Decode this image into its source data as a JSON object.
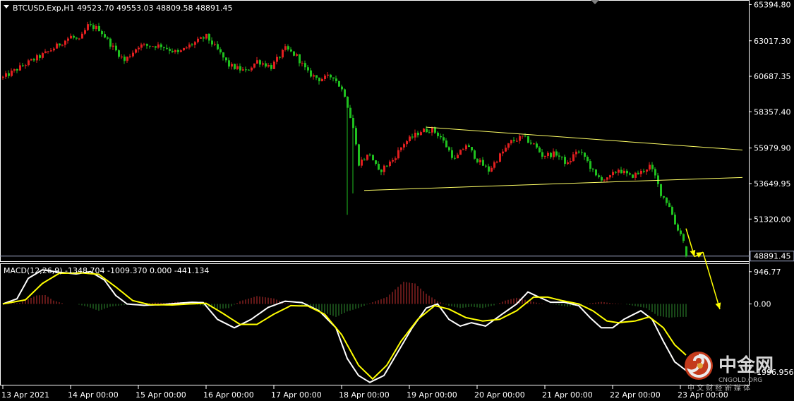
{
  "header": {
    "symbol_info": "BTCUSD.Exp,H1  49523.70 49553.03 48809.58 48891.45",
    "dropdown_icon": "triangle-down-icon"
  },
  "macd_header": "MACD(12,26,9) -1348.704 -1009.370 0.000 -441.134",
  "watermark": {
    "brand": "中金网",
    "domain": "CNGOLD.ORG",
    "tagline": "中 文 财 经 新 媒 体",
    "logo_icon": "cngold-swirl-logo-icon",
    "brand_color": "#d5401f"
  },
  "colors": {
    "background": "#000000",
    "bull": "#e21f1f",
    "bear": "#1fc01f",
    "trendline": "#ffff66",
    "arrow": "#ffff00",
    "macd_line": "#ffffff",
    "signal_line": "#ffff00",
    "hist_pos": "#c43131",
    "hist_neg": "#2f8f2f",
    "price_line": "#9fa8c8"
  },
  "chart_data": [
    {
      "type": "candlestick",
      "title": "BTCUSD.Exp,H1",
      "timeframe": "H1",
      "last_bar": {
        "open": 49523.7,
        "high": 49553.03,
        "low": 48809.58,
        "close": 48891.45
      },
      "current_price_label": "48891.45",
      "y_ticks": [
        "65394.80",
        "63017.30",
        "60687.35",
        "58357.40",
        "55979.90",
        "53649.95",
        "51320.00"
      ],
      "y_tick_values": [
        65394.8,
        63017.3,
        60687.35,
        58357.4,
        55979.9,
        53649.95,
        51320.0
      ],
      "ylim": [
        48600,
        65600
      ],
      "x_ticks": [
        "13 Apr 2021",
        "14 Apr 00:00",
        "15 Apr 00:00",
        "16 Apr 00:00",
        "17 Apr 00:00",
        "18 Apr 00:00",
        "19 Apr 00:00",
        "20 Apr 00:00",
        "21 Apr 00:00",
        "22 Apr 00:00",
        "23 Apr 00:00"
      ],
      "bar_count": 243,
      "close_path": [
        [
          0,
          60600
        ],
        [
          8,
          61500
        ],
        [
          16,
          62300
        ],
        [
          24,
          63300
        ],
        [
          27,
          63000
        ],
        [
          30,
          64000
        ],
        [
          34,
          63800
        ],
        [
          38,
          62800
        ],
        [
          43,
          61700
        ],
        [
          48,
          62700
        ],
        [
          56,
          62700
        ],
        [
          62,
          62200
        ],
        [
          66,
          62700
        ],
        [
          72,
          63300
        ],
        [
          76,
          62400
        ],
        [
          80,
          61400
        ],
        [
          86,
          61000
        ],
        [
          90,
          61700
        ],
        [
          95,
          61300
        ],
        [
          100,
          62500
        ],
        [
          104,
          62000
        ],
        [
          108,
          60900
        ],
        [
          112,
          60500
        ],
        [
          117,
          60700
        ],
        [
          121,
          59500
        ],
        [
          124,
          57300
        ],
        [
          126,
          55000
        ],
        [
          130,
          55600
        ],
        [
          133,
          54400
        ],
        [
          138,
          55200
        ],
        [
          142,
          56300
        ],
        [
          148,
          57100
        ],
        [
          152,
          57200
        ],
        [
          155,
          56700
        ],
        [
          160,
          55200
        ],
        [
          164,
          56200
        ],
        [
          168,
          55200
        ],
        [
          172,
          54500
        ],
        [
          176,
          55500
        ],
        [
          180,
          56400
        ],
        [
          184,
          56700
        ],
        [
          188,
          56200
        ],
        [
          191,
          55500
        ],
        [
          196,
          55600
        ],
        [
          200,
          54900
        ],
        [
          203,
          55800
        ],
        [
          206,
          55400
        ],
        [
          210,
          54100
        ],
        [
          214,
          53900
        ],
        [
          218,
          54600
        ],
        [
          222,
          54100
        ],
        [
          226,
          54400
        ],
        [
          229,
          54800
        ],
        [
          231,
          54100
        ],
        [
          233,
          53000
        ],
        [
          236,
          52200
        ],
        [
          238,
          51000
        ],
        [
          241,
          50000
        ],
        [
          242,
          48891.45
        ]
      ],
      "bar_anomalies": [
        {
          "index": 122,
          "low": 51600
        },
        {
          "index": 124,
          "low": 53000
        }
      ],
      "trendlines": [
        {
          "from": {
            "x": 150,
            "y": 57350
          },
          "to": {
            "x": 262,
            "y": 55850
          },
          "color": "trendline"
        },
        {
          "from": {
            "x": 128,
            "y": 53200
          },
          "to": {
            "x": 262,
            "y": 54050
          },
          "color": "trendline"
        }
      ],
      "arrows": [
        {
          "from": {
            "x": 242,
            "y": 50700
          },
          "to": {
            "x": 245,
            "y": 48850
          }
        },
        {
          "from": {
            "x": 245,
            "y": 48850
          },
          "to": {
            "x": 248,
            "y": 49150
          }
        },
        {
          "from": {
            "x": 248,
            "y": 49150
          },
          "to": {
            "x": 254,
            "y": 45400
          }
        }
      ]
    },
    {
      "type": "macd",
      "title": "MACD(12,26,9)",
      "values": {
        "macd": -1348.704,
        "signal": -1009.37,
        "zero": 0.0,
        "histogram": -441.134
      },
      "y_ticks": [
        "946.77",
        "0.00",
        "-1996.956"
      ],
      "y_tick_values": [
        946.77,
        0.0,
        -1996.956
      ],
      "ylim": [
        -2350,
        1150
      ],
      "bar_count": 243,
      "macd_path": [
        [
          0,
          0
        ],
        [
          5,
          150
        ],
        [
          9,
          750
        ],
        [
          14,
          1000
        ],
        [
          20,
          930
        ],
        [
          26,
          880
        ],
        [
          31,
          950
        ],
        [
          36,
          700
        ],
        [
          40,
          250
        ],
        [
          44,
          0
        ],
        [
          50,
          -40
        ],
        [
          56,
          -20
        ],
        [
          62,
          20
        ],
        [
          67,
          50
        ],
        [
          71,
          40
        ],
        [
          76,
          -450
        ],
        [
          82,
          -700
        ],
        [
          88,
          -450
        ],
        [
          94,
          -100
        ],
        [
          100,
          80
        ],
        [
          106,
          40
        ],
        [
          112,
          -200
        ],
        [
          118,
          -700
        ],
        [
          122,
          -1600
        ],
        [
          126,
          -2100
        ],
        [
          130,
          -2300
        ],
        [
          135,
          -2100
        ],
        [
          140,
          -1400
        ],
        [
          145,
          -700
        ],
        [
          150,
          -120
        ],
        [
          154,
          0
        ],
        [
          158,
          -450
        ],
        [
          162,
          -650
        ],
        [
          166,
          -550
        ],
        [
          171,
          -650
        ],
        [
          176,
          -350
        ],
        [
          182,
          0
        ],
        [
          186,
          350
        ],
        [
          190,
          200
        ],
        [
          194,
          50
        ],
        [
          199,
          50
        ],
        [
          204,
          -50
        ],
        [
          208,
          -400
        ],
        [
          212,
          -700
        ],
        [
          216,
          -700
        ],
        [
          220,
          -450
        ],
        [
          226,
          -200
        ],
        [
          230,
          -450
        ],
        [
          234,
          -1100
        ],
        [
          238,
          -1700
        ],
        [
          242,
          -1950
        ]
      ],
      "signal_path": [
        [
          0,
          0
        ],
        [
          8,
          120
        ],
        [
          14,
          600
        ],
        [
          20,
          900
        ],
        [
          28,
          910
        ],
        [
          34,
          870
        ],
        [
          40,
          500
        ],
        [
          46,
          100
        ],
        [
          52,
          -20
        ],
        [
          60,
          -30
        ],
        [
          66,
          0
        ],
        [
          72,
          20
        ],
        [
          78,
          -280
        ],
        [
          84,
          -600
        ],
        [
          90,
          -600
        ],
        [
          96,
          -300
        ],
        [
          102,
          -50
        ],
        [
          108,
          -60
        ],
        [
          114,
          -300
        ],
        [
          120,
          -900
        ],
        [
          126,
          -1800
        ],
        [
          131,
          -2200
        ],
        [
          136,
          -1800
        ],
        [
          141,
          -1100
        ],
        [
          147,
          -450
        ],
        [
          153,
          -50
        ],
        [
          158,
          -150
        ],
        [
          164,
          -400
        ],
        [
          170,
          -500
        ],
        [
          176,
          -450
        ],
        [
          182,
          -200
        ],
        [
          188,
          200
        ],
        [
          193,
          200
        ],
        [
          198,
          100
        ],
        [
          204,
          0
        ],
        [
          209,
          -200
        ],
        [
          214,
          -500
        ],
        [
          218,
          -550
        ],
        [
          224,
          -500
        ],
        [
          229,
          -380
        ],
        [
          234,
          -700
        ],
        [
          238,
          -1200
        ],
        [
          242,
          -1500
        ]
      ],
      "histogram_path": [
        [
          0,
          0
        ],
        [
          6,
          30
        ],
        [
          12,
          250
        ],
        [
          15,
          260
        ],
        [
          18,
          100
        ],
        [
          22,
          0
        ],
        [
          26,
          0
        ],
        [
          30,
          -80
        ],
        [
          34,
          -200
        ],
        [
          38,
          -80
        ],
        [
          42,
          -40
        ],
        [
          48,
          0
        ],
        [
          54,
          40
        ],
        [
          58,
          30
        ],
        [
          62,
          60
        ],
        [
          66,
          40
        ],
        [
          72,
          -80
        ],
        [
          76,
          -150
        ],
        [
          80,
          -120
        ],
        [
          84,
          80
        ],
        [
          90,
          230
        ],
        [
          96,
          160
        ],
        [
          100,
          20
        ],
        [
          104,
          0
        ],
        [
          108,
          -60
        ],
        [
          114,
          -260
        ],
        [
          118,
          -380
        ],
        [
          122,
          -220
        ],
        [
          126,
          -120
        ],
        [
          130,
          20
        ],
        [
          136,
          200
        ],
        [
          142,
          650
        ],
        [
          146,
          600
        ],
        [
          150,
          300
        ],
        [
          154,
          80
        ],
        [
          158,
          -50
        ],
        [
          162,
          -120
        ],
        [
          166,
          -80
        ],
        [
          170,
          -120
        ],
        [
          174,
          -40
        ],
        [
          178,
          100
        ],
        [
          182,
          180
        ],
        [
          186,
          100
        ],
        [
          190,
          20
        ],
        [
          196,
          -20
        ],
        [
          200,
          -80
        ],
        [
          204,
          -30
        ],
        [
          208,
          20
        ],
        [
          212,
          60
        ],
        [
          216,
          20
        ],
        [
          220,
          0
        ],
        [
          224,
          -60
        ],
        [
          228,
          -120
        ],
        [
          232,
          -350
        ],
        [
          236,
          -400
        ],
        [
          240,
          -380
        ],
        [
          242,
          -380
        ]
      ]
    }
  ]
}
